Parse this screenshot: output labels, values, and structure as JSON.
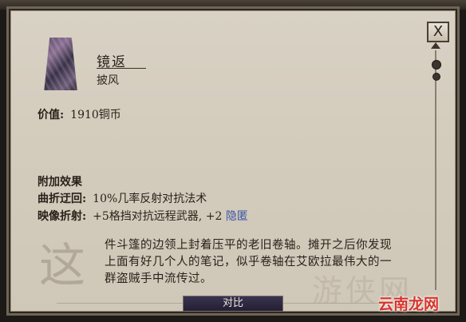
{
  "close_label": "X",
  "item": {
    "name": "镜返",
    "type": "披风",
    "icon": "cloak-icon"
  },
  "value": {
    "label": "价值:",
    "amount": "1910铜币"
  },
  "effects": {
    "title": "附加效果",
    "rows": [
      {
        "label": "曲折迂回:",
        "text": "10%几率反射对抗法术",
        "extra": ""
      },
      {
        "label": "映像折射:",
        "text": "+5格挡对抗远程武器, +2",
        "extra": "隐匿"
      }
    ]
  },
  "description": {
    "drop_cap": "这",
    "lines": [
      "件斗篷的边领上封着压平的老旧卷轴。摊开之后你发现",
      "上面有好几个人的笔记，似乎卷轴在艾欧拉最伟大的一",
      "群盗贼手中流传过。"
    ]
  },
  "compare_label": "对比",
  "watermark_faint": "游侠网",
  "site_badge": "云南龙网",
  "colors": {
    "parchment": "#d6cfc0",
    "link": "#3b55a6",
    "badge": "#d6342c",
    "button_bg": "#2e2940"
  }
}
